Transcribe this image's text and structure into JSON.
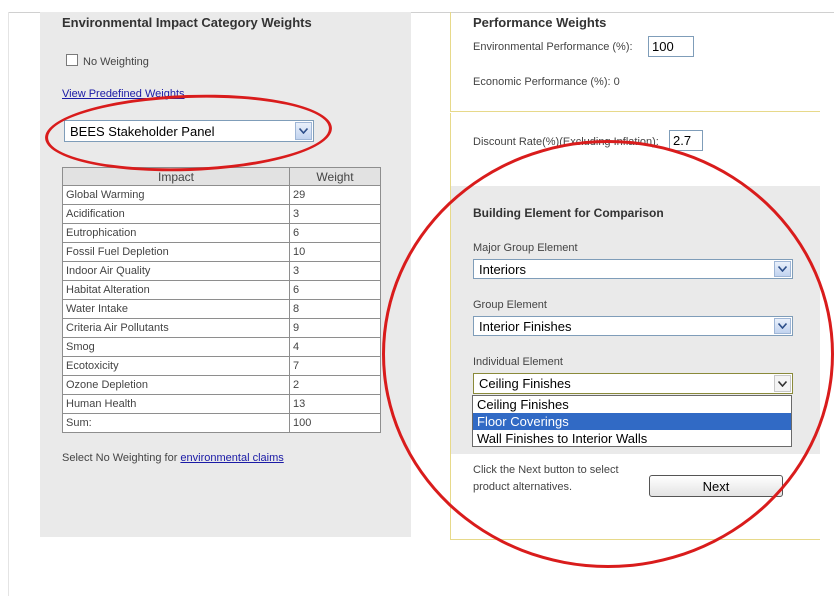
{
  "left": {
    "title": "Environmental Impact Category Weights",
    "no_weighting_label": "No Weighting",
    "view_weights_link": "View Predefined Weights",
    "panel_select": "BEES Stakeholder Panel",
    "table": {
      "headers": [
        "Impact",
        "Weight"
      ],
      "rows": [
        [
          "Global Warming",
          "29"
        ],
        [
          "Acidification",
          "3"
        ],
        [
          "Eutrophication",
          "6"
        ],
        [
          "Fossil Fuel Depletion",
          "10"
        ],
        [
          "Indoor Air Quality",
          "3"
        ],
        [
          "Habitat Alteration",
          "6"
        ],
        [
          "Water Intake",
          "8"
        ],
        [
          "Criteria Air Pollutants",
          "9"
        ],
        [
          "Smog",
          "4"
        ],
        [
          "Ecotoxicity",
          "7"
        ],
        [
          "Ozone Depletion",
          "2"
        ],
        [
          "Human Health",
          "13"
        ],
        [
          "Sum:",
          "100"
        ]
      ]
    },
    "footer_text": "Select No Weighting for ",
    "footer_link": "environmental claims"
  },
  "performance": {
    "title": "Performance Weights",
    "env_label": "Environmental Performance (%):",
    "env_value": "100",
    "econ_label": "Economic Performance (%): 0"
  },
  "discount": {
    "label": "Discount Rate(%)(Excluding Inflation):",
    "value": "2.7"
  },
  "comparison": {
    "title": "Building Element for Comparison",
    "major_label": "Major Group Element",
    "major_value": "Interiors",
    "group_label": "Group Element",
    "group_value": "Interior Finishes",
    "individual_label": "Individual Element",
    "individual_value": "Ceiling Finishes",
    "options": [
      "Ceiling Finishes",
      "Floor Coverings",
      "Wall Finishes to Interior Walls"
    ],
    "highlighted_option": "Floor Coverings"
  },
  "next": {
    "instruction_line1": "Click the Next button to select",
    "instruction_line2": "product alternatives.",
    "button": "Next"
  },
  "colors": {
    "annotation_ring": "#d91c1c",
    "highlight": "#316ac5",
    "panel_gray": "#eaeaea",
    "panel_border": "#e7d98a"
  }
}
